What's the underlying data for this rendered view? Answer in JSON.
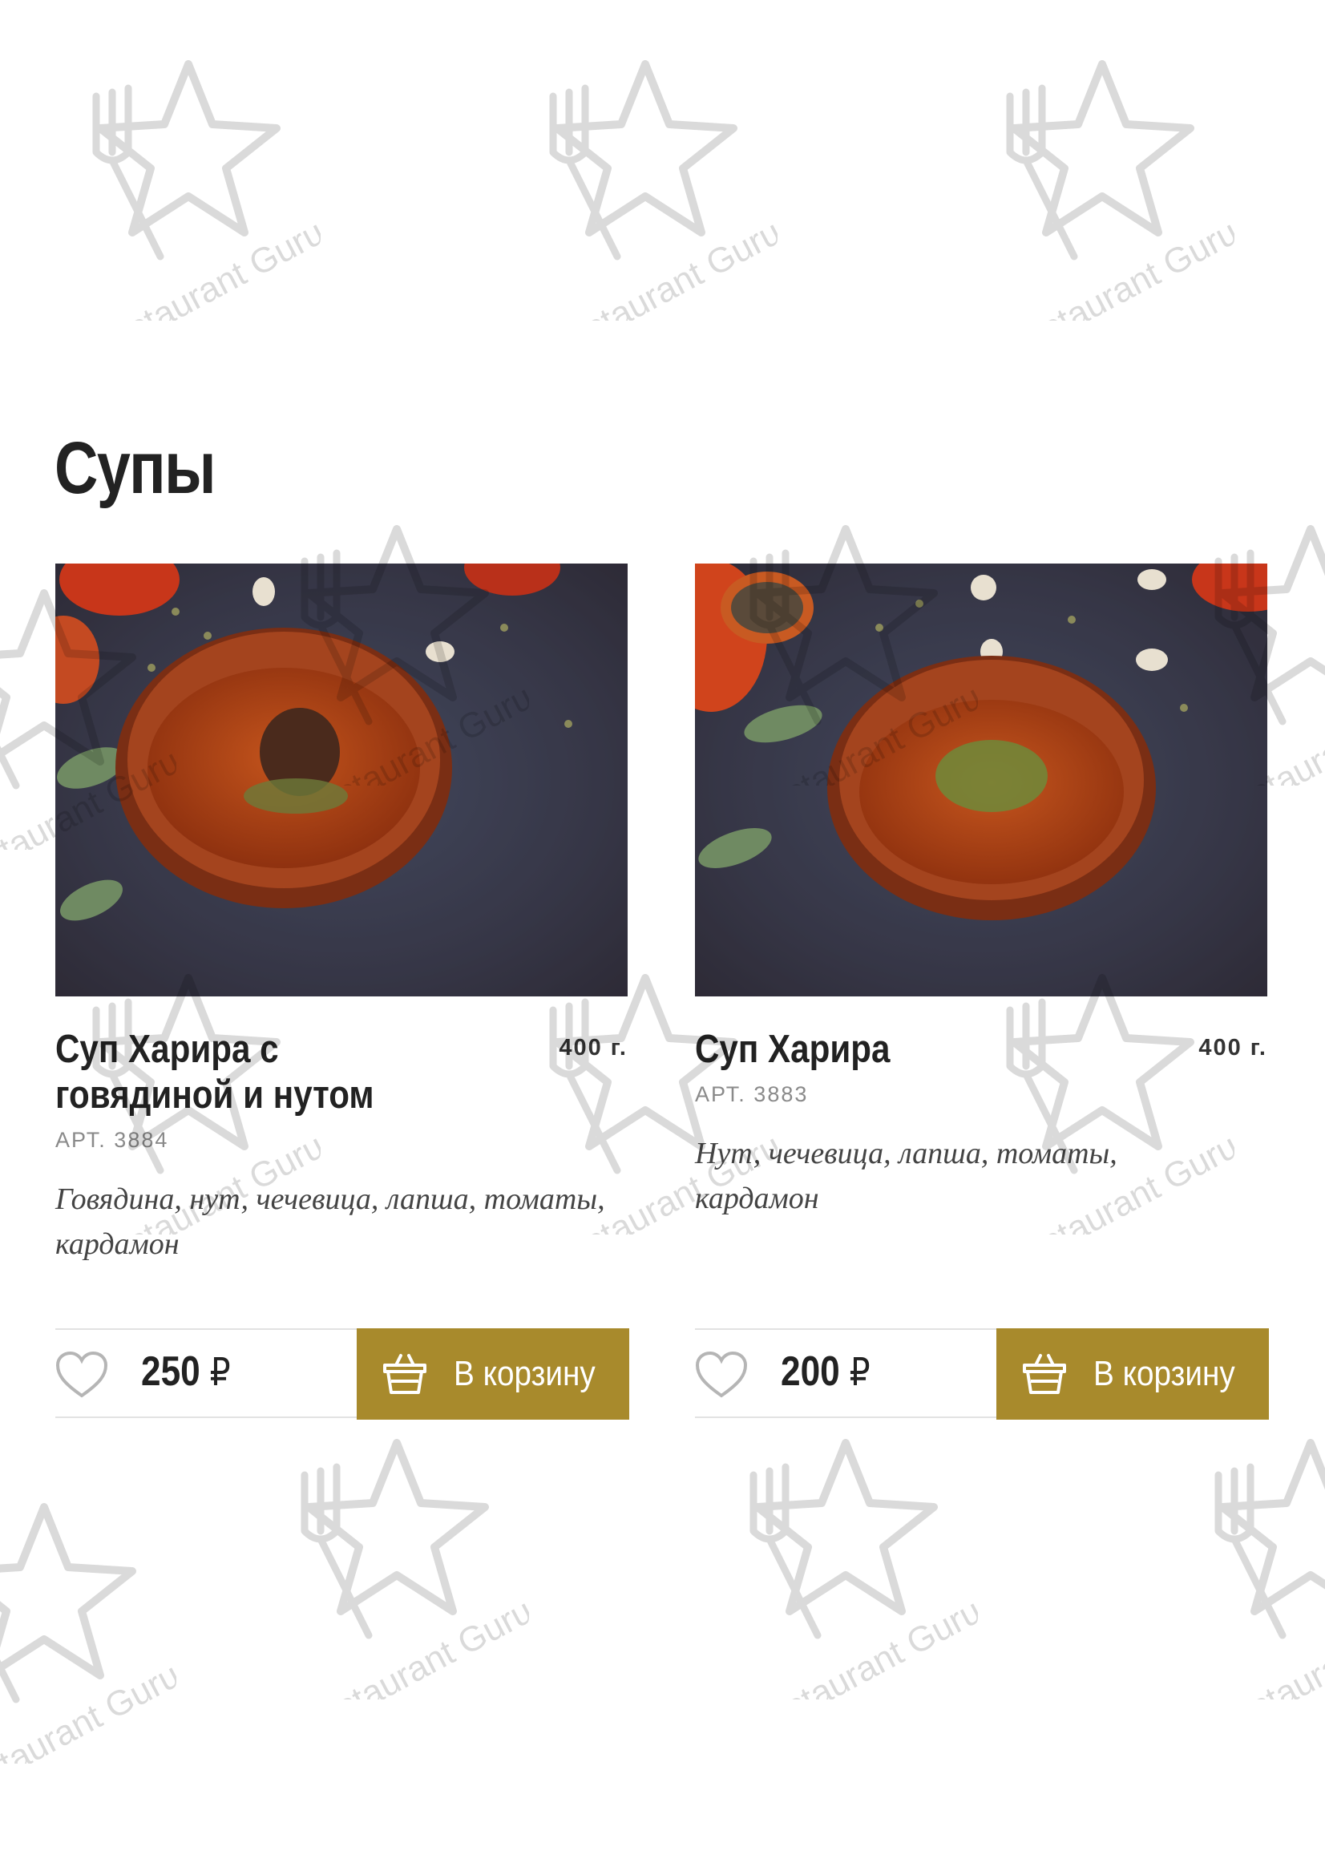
{
  "watermark": {
    "text": "Restaurant Guru",
    "icon": "restaurant-guru-star-fork-logo"
  },
  "section": {
    "title": "Супы"
  },
  "products": [
    {
      "name": "Суп Харира с говядиной и нутом",
      "weight": "400 г.",
      "article": "АРТ. 3884",
      "description": "Говядина, нут, чечевица, лапша, томаты, кардамон",
      "price": "250",
      "currency": "₽",
      "cart_label": "В корзину",
      "image": "harira-soup-with-beef-photo"
    },
    {
      "name": "Суп Харира",
      "weight": "400 г.",
      "article": "АРТ. 3883",
      "description": "Нут, чечевица, лапша, томаты, кардамон",
      "price": "200",
      "currency": "₽",
      "cart_label": "В корзину",
      "image": "harira-soup-photo"
    }
  ],
  "colors": {
    "accent": "#a88a2c",
    "text": "#222222",
    "muted": "#8a8a8a",
    "divider": "#e2e2e2"
  },
  "icons": {
    "favorite": "heart-outline-icon",
    "cart": "basket-icon"
  }
}
